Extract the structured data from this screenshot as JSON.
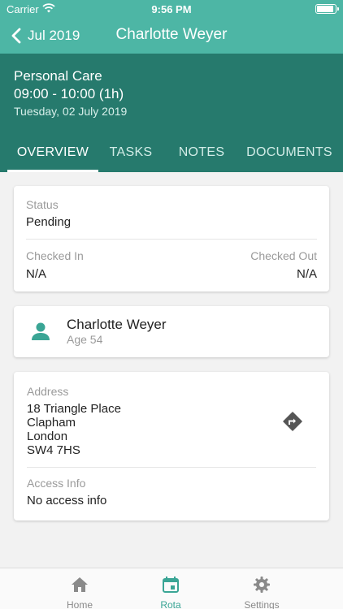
{
  "status_bar": {
    "carrier": "Carrier",
    "time": "9:56 PM"
  },
  "nav": {
    "back_label": "Jul 2019",
    "title": "Charlotte Weyer"
  },
  "header": {
    "service": "Personal Care",
    "time_range": "09:00 - 10:00 (1h)",
    "date": "Tuesday, 02 July 2019"
  },
  "tabs": [
    {
      "label": "OVERVIEW",
      "active": true
    },
    {
      "label": "TASKS",
      "active": false
    },
    {
      "label": "NOTES",
      "active": false
    },
    {
      "label": "DOCUMENTS",
      "active": false
    }
  ],
  "status_card": {
    "status_label": "Status",
    "status_value": "Pending",
    "checked_in_label": "Checked In",
    "checked_in_value": "N/A",
    "checked_out_label": "Checked Out",
    "checked_out_value": "N/A"
  },
  "person": {
    "name": "Charlotte Weyer",
    "age": "Age 54"
  },
  "address_card": {
    "address_label": "Address",
    "address_lines": [
      "18 Triangle Place",
      "Clapham",
      "London",
      "SW4 7HS"
    ],
    "access_label": "Access Info",
    "access_value": "No access info"
  },
  "bottom_tabs": [
    {
      "label": "Home",
      "icon": "home-icon",
      "active": false
    },
    {
      "label": "Rota",
      "icon": "calendar-icon",
      "active": true
    },
    {
      "label": "Settings",
      "icon": "gear-icon",
      "active": false
    }
  ],
  "colors": {
    "primary": "#4db6a5",
    "primary_dark": "#267a6d",
    "icon_accent": "#3aa595",
    "icon_muted": "#9a9a9a"
  }
}
